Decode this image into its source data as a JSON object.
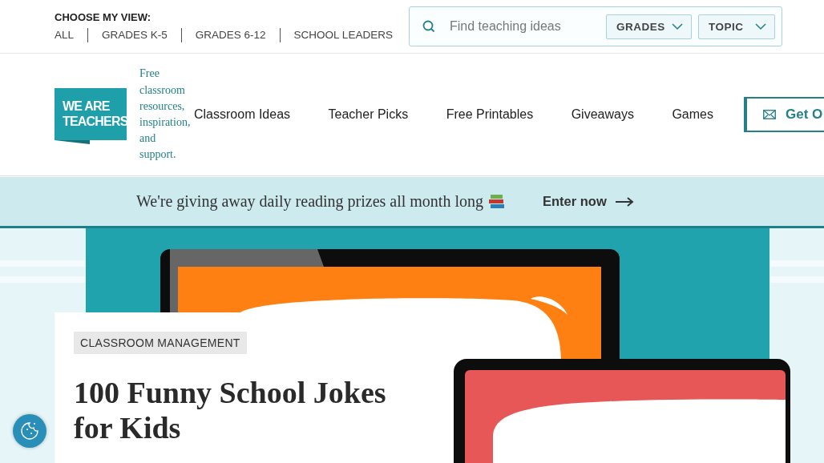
{
  "view_switcher": {
    "label": "CHOOSE MY VIEW:",
    "options": [
      "ALL",
      "GRADES K-5",
      "GRADES 6-12",
      "SCHOOL LEADERS"
    ]
  },
  "search": {
    "placeholder": "Find teaching ideas",
    "filters": [
      "GRADES",
      "TOPIC"
    ]
  },
  "logo": {
    "line_1": "WE ARE",
    "line_2": "TEACHERS"
  },
  "tagline": "Free classroom resources, inspiration, and support.",
  "nav": [
    "Classroom Ideas",
    "Teacher Picks",
    "Free Printables",
    "Giveaways",
    "Games"
  ],
  "subscribe_button": "Get O",
  "banner": {
    "text": "We're giving away daily reading prizes all month long",
    "link": "Enter now"
  },
  "article": {
    "category": "CLASSROOM MANAGEMENT",
    "title": "100 Funny School Jokes for Kids"
  }
}
